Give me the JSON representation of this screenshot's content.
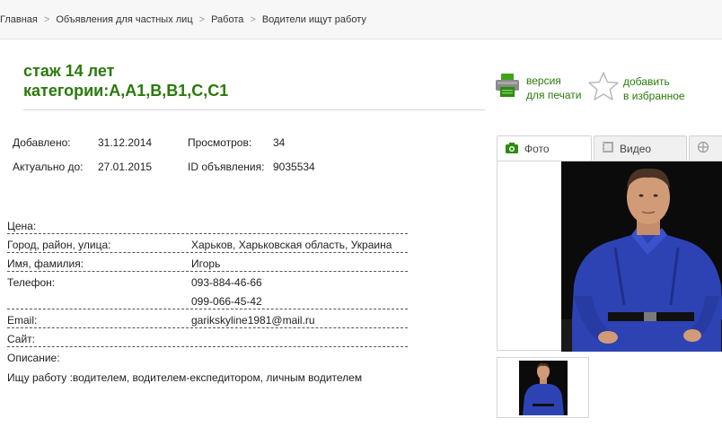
{
  "breadcrumb": {
    "items": [
      "Главная",
      "Объявления для частных лиц",
      "Работа",
      "Водители ищут работу"
    ],
    "separator": ">"
  },
  "listing": {
    "title_line1": "стаж 14 лет",
    "title_line2": "категории:A,A1,B,B1,C,C1"
  },
  "tools": {
    "print_line1": "версия",
    "print_line2": "для печати",
    "fav_line1": "добавить",
    "fav_line2": "в избранное"
  },
  "meta": {
    "added_label": "Добавлено:",
    "added_value": "31.12.2014",
    "actual_label": "Актуально до:",
    "actual_value": "27.01.2015",
    "views_label": "Просмотров:",
    "views_value": "34",
    "id_label": "ID объявления:",
    "id_value": "9035534"
  },
  "fields": {
    "price_label": "Цена:",
    "city_label": "Город, район, улица:",
    "city_value": "Харьков, Харьковская область, Украина",
    "name_label": "Имя, фамилия:",
    "name_value": "Игорь",
    "phone_label": "Телефон:",
    "phone1": "093-884-46-66",
    "phone2": "099-066-45-42",
    "email_label": "Email:",
    "email_value": "garikskyline1981@mail.ru",
    "site_label": "Сайт:",
    "desc_label": "Описание:",
    "desc_value": "Ищу работу :водителем, водителем-експедитором, личным водителем"
  },
  "media_tabs": {
    "photo": "Фото",
    "video": "Видео"
  },
  "colors": {
    "accent_green": "#2a7a0b",
    "shirt_blue": "#2d43b4",
    "photo_bg": "#0b0b0b"
  }
}
